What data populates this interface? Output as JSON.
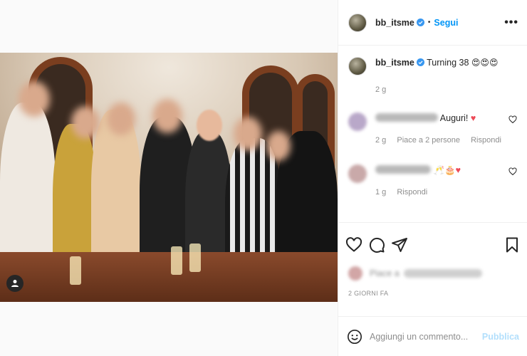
{
  "post": {
    "author": "bb_itsme",
    "follow_label": "Segui",
    "dot": "•",
    "more_label": "•••"
  },
  "caption": {
    "author": "bb_itsme",
    "text": "Turning 38",
    "emojis": "😍😍😍",
    "time": "2 g"
  },
  "comments": [
    {
      "text": "Auguri!",
      "emoji": "♥",
      "time": "2 g",
      "likes": "Piace a 2 persone",
      "reply": "Rispondi"
    },
    {
      "emoji": "🥂🎂♥",
      "time": "1 g",
      "reply": "Rispondi"
    }
  ],
  "likes_line": "Piace a",
  "date": "2 GIORNI FA",
  "add_comment": {
    "placeholder": "Aggiungi un commento...",
    "publish": "Pubblica"
  },
  "colors": {
    "accent": "#0095f6",
    "publish_disabled": "#b2dffc",
    "heart": "#ed4956"
  }
}
